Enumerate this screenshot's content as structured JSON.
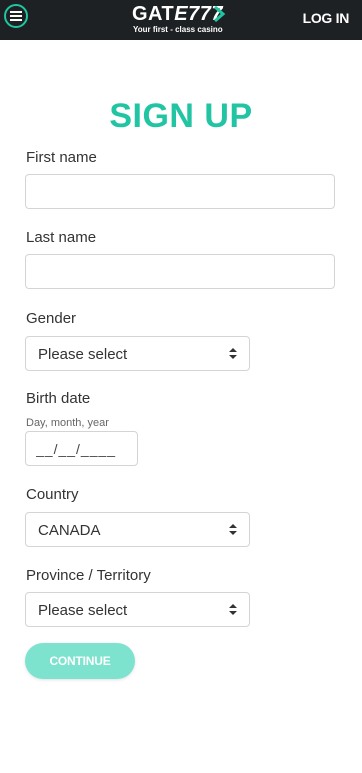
{
  "header": {
    "brand_main": "GAT",
    "brand_numbers": "E777",
    "tagline": "Your first - class casino",
    "login_label": "LOG IN",
    "menu_icon": "hamburger-menu-icon",
    "accent_color": "#21c4a3",
    "bar_color": "#1e2124"
  },
  "form": {
    "title": "SIGN UP",
    "first_name": {
      "label": "First name",
      "value": ""
    },
    "last_name": {
      "label": "Last name",
      "value": ""
    },
    "gender": {
      "label": "Gender",
      "selected": "Please select"
    },
    "birth_date": {
      "label": "Birth date",
      "hint": "Day, month, year",
      "placeholder": "__/__/____"
    },
    "country": {
      "label": "Country",
      "selected": "CANADA"
    },
    "province": {
      "label": "Province / Territory",
      "selected": "Please select"
    },
    "select_icon": "sort-arrows-icon",
    "submit_label": "CONTINUE",
    "submit_color": "#7de3cf"
  }
}
